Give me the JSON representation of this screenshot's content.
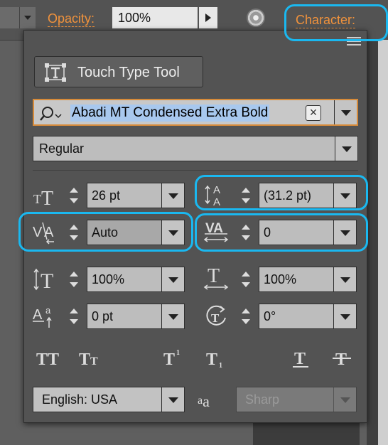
{
  "toolbar": {
    "opacity_label": "Opacity:",
    "opacity_value": "100%",
    "character_label": "Character:"
  },
  "panel": {
    "touch_type_label": "Touch Type Tool",
    "font_family": "Abadi MT Condensed Extra Bold",
    "font_style": "Regular",
    "font_size": "26 pt",
    "leading": "(31.2 pt)",
    "kerning": "Auto",
    "tracking": "0",
    "vertical_scale": "100%",
    "horizontal_scale": "100%",
    "baseline_shift": "0 pt",
    "rotation": "0°",
    "language": "English: USA",
    "anti_alias": "Sharp",
    "aa_glyph": "a",
    "aa_glyph2": "a"
  },
  "highlight_color": "#1ab8f0",
  "accent_color": "#f0923c"
}
